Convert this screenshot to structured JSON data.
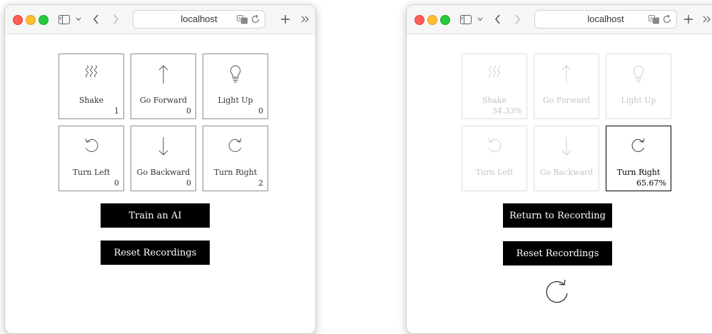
{
  "left_window": {
    "address": "localhost",
    "tiles": [
      {
        "label": "Shake",
        "count": "1",
        "icon": "shake-icon"
      },
      {
        "label": "Go Forward",
        "count": "0",
        "icon": "arrow-up-icon"
      },
      {
        "label": "Light Up",
        "count": "0",
        "icon": "lightbulb-icon"
      },
      {
        "label": "Turn Left",
        "count": "0",
        "icon": "rotate-left-icon"
      },
      {
        "label": "Go Backward",
        "count": "0",
        "icon": "arrow-down-icon"
      },
      {
        "label": "Turn Right",
        "count": "2",
        "icon": "rotate-right-icon"
      }
    ],
    "train_button": "Train an AI",
    "reset_button": "Reset Recordings"
  },
  "right_window": {
    "address": "localhost",
    "tiles": [
      {
        "label": "Shake",
        "count": "34.33%",
        "icon": "shake-icon",
        "state": "faded"
      },
      {
        "label": "Go Forward",
        "count": "",
        "icon": "arrow-up-icon",
        "state": "faded"
      },
      {
        "label": "Light Up",
        "count": "",
        "icon": "lightbulb-icon",
        "state": "faded"
      },
      {
        "label": "Turn Left",
        "count": "",
        "icon": "rotate-left-icon",
        "state": "faded"
      },
      {
        "label": "Go Backward",
        "count": "",
        "icon": "arrow-down-icon",
        "state": "faded"
      },
      {
        "label": "Turn Right",
        "count": "65.67%",
        "icon": "rotate-right-icon",
        "state": "active"
      }
    ],
    "return_button": "Return to Recording",
    "reset_button": "Reset Recordings",
    "loading_icon": "loading-spinner-icon"
  },
  "colors": {
    "button_bg": "#000000",
    "button_text": "#ffffff",
    "tile_border": "#8e8e8e",
    "tile_faded": "#dcdcdc",
    "tile_active": "#000000",
    "close": "#ff5f57",
    "minimize": "#febc2e",
    "zoom": "#28c840"
  }
}
